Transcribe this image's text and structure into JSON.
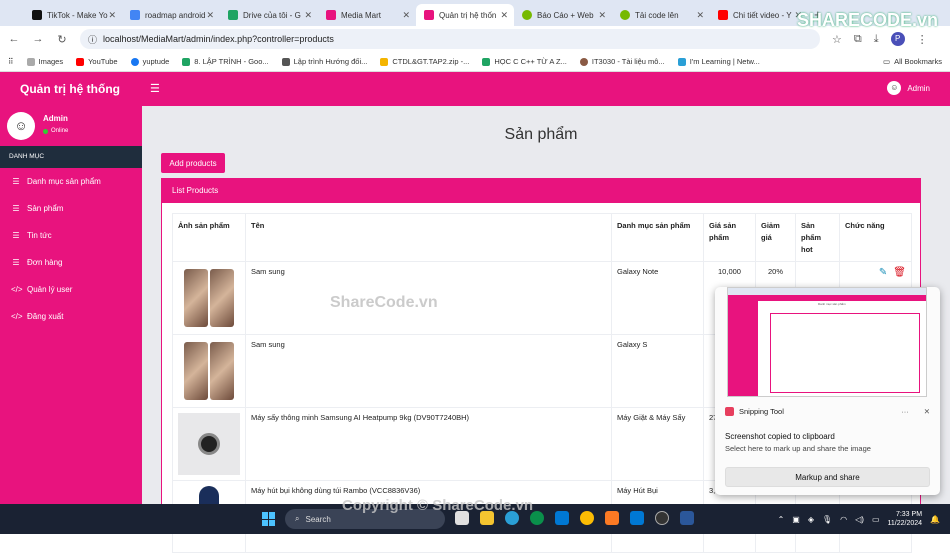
{
  "browser": {
    "tabs": [
      {
        "title": "TikTok - Make Yo",
        "color": "#111111"
      },
      {
        "title": "roadmap android",
        "color": "#4285f4"
      },
      {
        "title": "Drive của tôi - G",
        "color": "#1fa463"
      },
      {
        "title": "Media Mart",
        "color": "#e8137e"
      },
      {
        "title": "Quản trị hệ thốn",
        "color": "#e8137e",
        "active": true
      },
      {
        "title": "Báo Cáo + Web",
        "color": "#76b900"
      },
      {
        "title": "Tải code lên",
        "color": "#76b900"
      },
      {
        "title": "Chi tiết video - Y",
        "color": "#ff0000"
      }
    ],
    "url": "localhost/MediaMart/admin/index.php?controller=products",
    "bookmarks": [
      "Images",
      "YouTube",
      "yuptude",
      "8. LẬP TRÌNH - Goo...",
      "Lập trình Hướng đối...",
      "CTDL&GT.TAP2.zip -...",
      "HỌC C C++ TỪ A Z...",
      "IT3030 - Tài liệu mô...",
      "I'm Learning | Netw..."
    ],
    "bookmarks_all": "All Bookmarks"
  },
  "admin": {
    "brand": "Quản trị hệ thống",
    "top_user": "Admin",
    "user_name": "Admin",
    "user_status": "Online",
    "menu_header": "DANH MỤC",
    "menu": [
      "Danh mục sản phẩm",
      "Sản phẩm",
      "Tin tức",
      "Đơn hàng",
      "Quản lý user",
      "Đăng xuất"
    ]
  },
  "page": {
    "title": "Sản phẩm",
    "add_button": "Add products",
    "card_title": "List Products",
    "columns": [
      "Ảnh sản phẩm",
      "Tên",
      "Danh mục sản phẩm",
      "Giá sản phẩm",
      "Giảm giá",
      "Sản phẩm hot",
      "Chức năng"
    ],
    "rows": [
      {
        "name": "Sam sung",
        "category": "Galaxy Note",
        "price": "10,000",
        "discount": "20%",
        "hot": ""
      },
      {
        "name": "Sam sung",
        "category": "Galaxy S",
        "price": "",
        "discount": "",
        "hot": ""
      },
      {
        "name": "Máy sấy thông minh Samsung AI Heatpump 9kg (DV90T7240BH)",
        "category": "Máy Giặt & Máy Sấy",
        "price": "27",
        "discount": "",
        "hot": ""
      },
      {
        "name": "Máy hút bụi không dùng túi Rambo (VCC8836V36)",
        "category": "Máy Hút Bụi",
        "price": "3,",
        "discount": "",
        "hot": ""
      }
    ]
  },
  "snipping": {
    "app": "Snipping Tool",
    "message": "Screenshot copied to clipboard",
    "sub": "Select here to mark up and share the image",
    "button": "Markup and share",
    "thumb_title": "Danh mục sản phẩm"
  },
  "taskbar": {
    "search": "Search",
    "time": "7:33 PM",
    "date": "11/22/2024"
  },
  "watermarks": {
    "logo": "SHARECODE.vn",
    "center": "ShareCode.vn",
    "bottom": "Copyright © ShareCode.vn"
  }
}
